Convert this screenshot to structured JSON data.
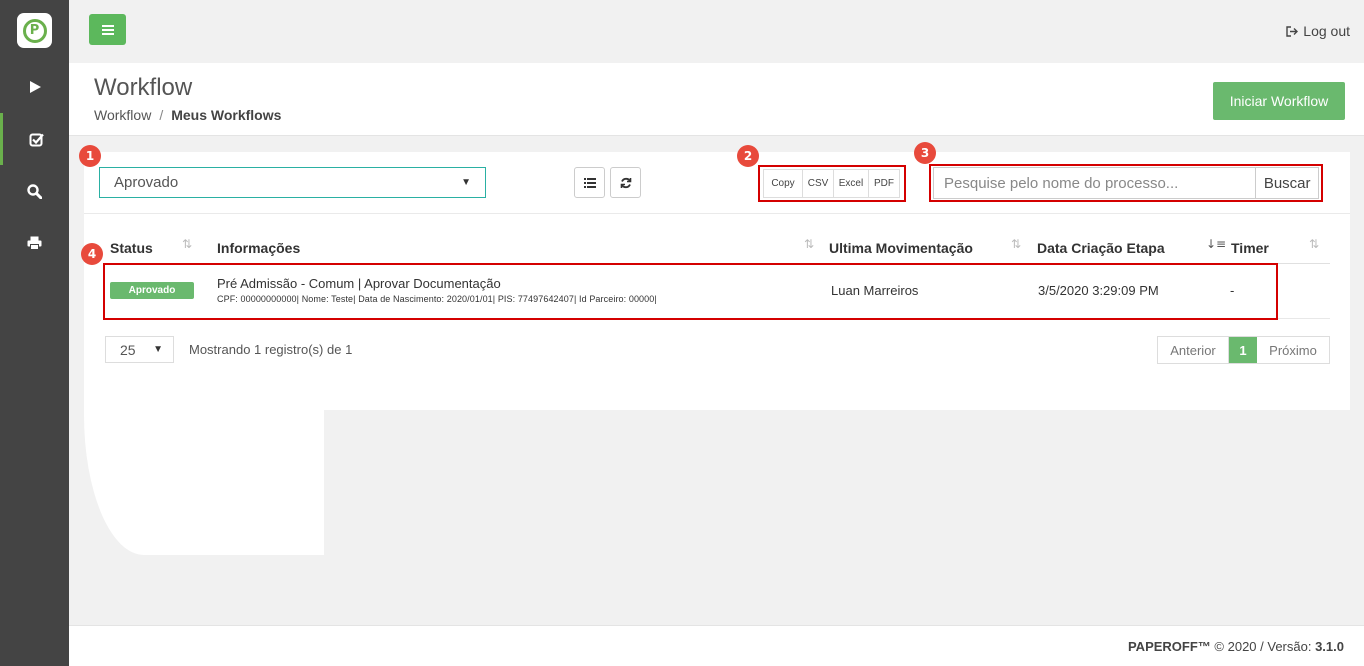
{
  "sidebar": {
    "logo_letter": "P",
    "items": [
      {
        "name": "play",
        "active": false
      },
      {
        "name": "check-square",
        "active": true
      },
      {
        "name": "search",
        "active": false
      },
      {
        "name": "print",
        "active": false
      }
    ],
    "accent": "#6ab04c"
  },
  "topbar": {
    "logout_label": "Log out"
  },
  "header": {
    "title": "Workflow",
    "breadcrumb_root": "Workflow",
    "breadcrumb_sep": "/",
    "breadcrumb_current": "Meus Workflows",
    "start_button": "Iniciar Workflow"
  },
  "filters": {
    "status_value": "Aprovado",
    "export_buttons": [
      "Copy",
      "CSV",
      "Excel",
      "PDF"
    ],
    "search_placeholder": "Pesquise pelo nome do processo...",
    "search_button": "Buscar"
  },
  "markers": [
    "1",
    "2",
    "3",
    "4"
  ],
  "table": {
    "columns": [
      "Status",
      "Informações",
      "Ultima Movimentação",
      "Data Criação Etapa",
      "Timer"
    ],
    "rows": [
      {
        "status": "Aprovado",
        "title": "Pré Admissão - Comum | Aprovar Documentação",
        "detail": "CPF: 00000000000| Nome: Teste| Data de Nascimento: 2020/01/01| PIS: 77497642407| Id Parceiro: 00000|",
        "last_movement": "Luan Marreiros",
        "created": "3/5/2020 3:29:09 PM",
        "timer": "-"
      }
    ]
  },
  "pagination": {
    "page_size": "25",
    "showing": "Mostrando 1 registro(s) de 1",
    "prev": "Anterior",
    "current": "1",
    "next": "Próximo"
  },
  "footer": {
    "brand": "PAPEROFF™",
    "text": "© 2020 / Versão:",
    "version": "3.1.0"
  },
  "colors": {
    "green": "#6ab96e",
    "highlight": "#d40000",
    "marker": "#e84a3c"
  }
}
